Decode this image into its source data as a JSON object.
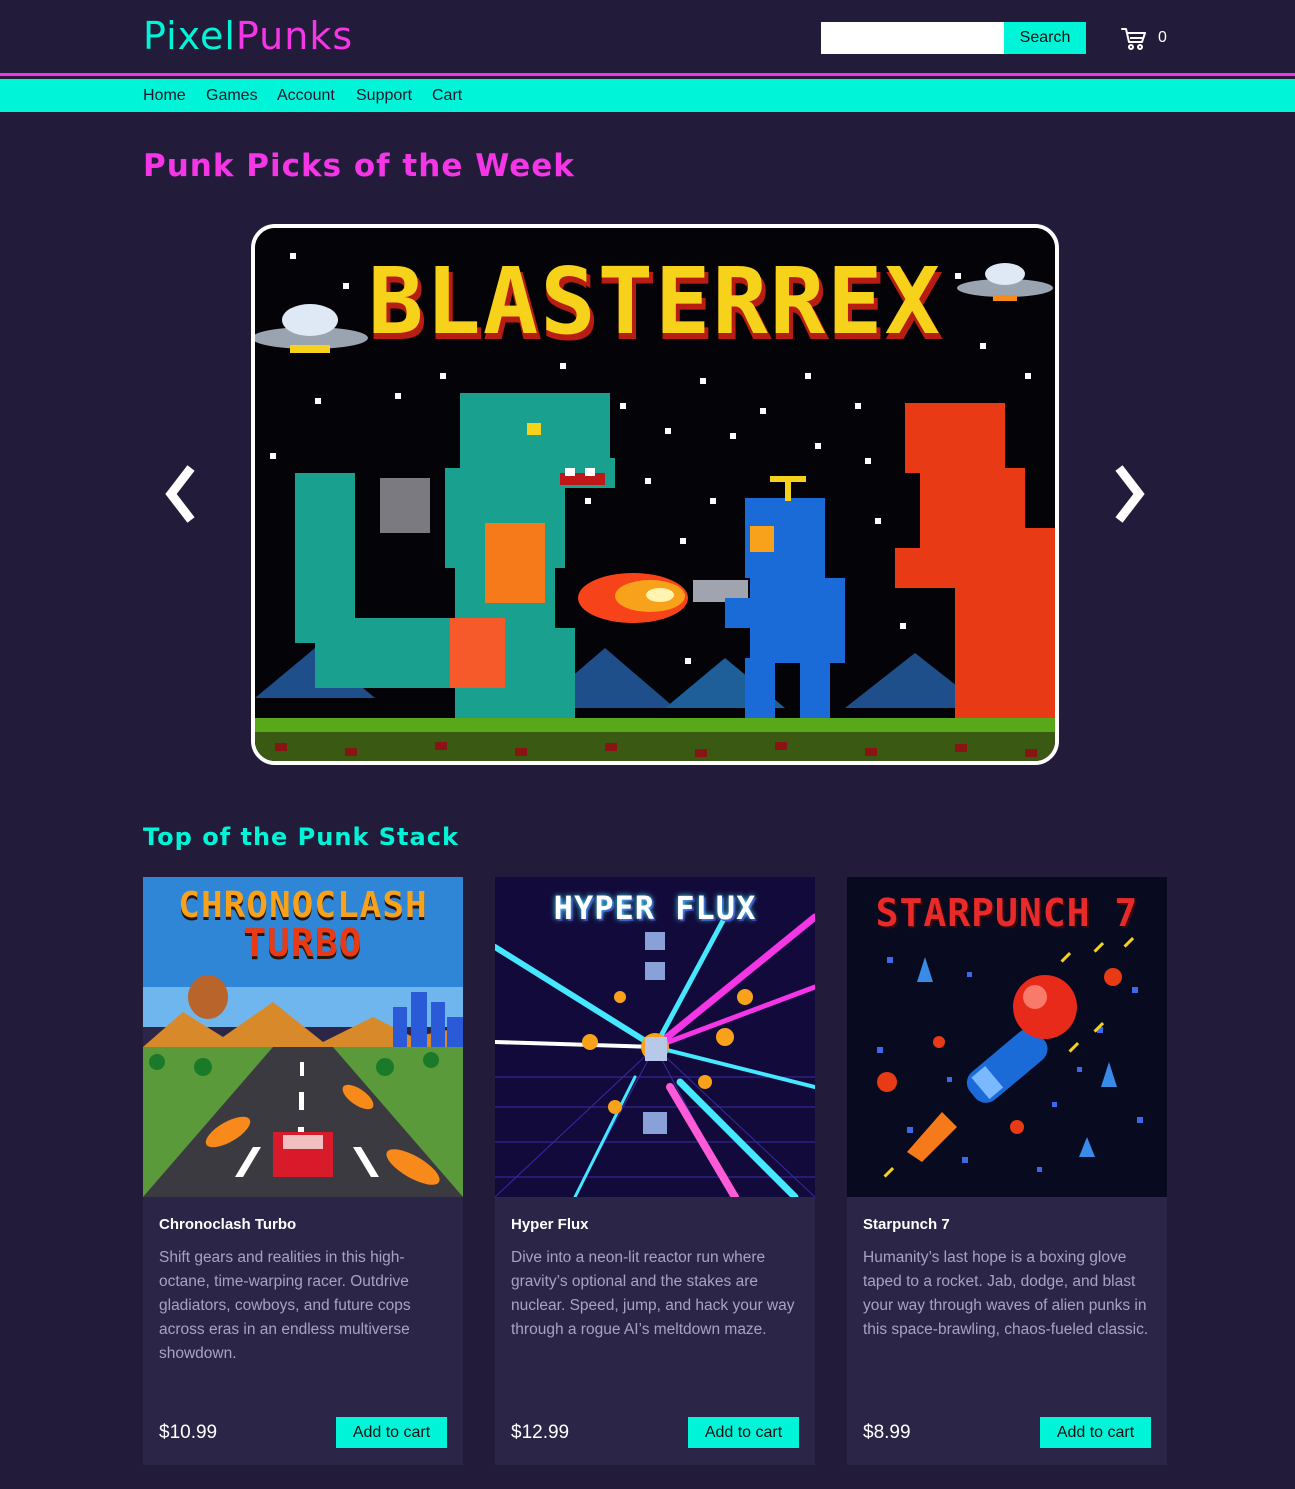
{
  "brand": {
    "logo_part1": "Pixel",
    "logo_part2": "Punks"
  },
  "header": {
    "search_placeholder": "",
    "search_button": "Search",
    "cart_icon": "cart-icon",
    "cart_count": "0"
  },
  "nav": [
    "Home",
    "Games",
    "Account",
    "Support",
    "Cart"
  ],
  "picks": {
    "title": "Punk Picks of the Week",
    "prev_icon": "chevron-left-icon",
    "next_icon": "chevron-right-icon",
    "slide_title": "BLASTERREX"
  },
  "stack": {
    "title": "Top of the Punk Stack",
    "games": [
      {
        "art_title_1": "CHRONOCLASH",
        "art_title_2": "TURBO",
        "name": "Chronoclash Turbo",
        "description": "Shift gears and realities in this high-octane, time-warping racer. Outdrive gladiators, cowboys, and future cops across eras in an endless multiverse showdown.",
        "price": "$10.99",
        "button": "Add to cart"
      },
      {
        "art_title_1": "HYPER FLUX",
        "name": "Hyper Flux",
        "description": "Dive into a neon-lit reactor run where gravity’s optional and the stakes are nuclear. Speed, jump, and hack your way through a rogue AI’s meltdown maze.",
        "price": "$12.99",
        "button": "Add to cart"
      },
      {
        "art_title_1": "STARPUNCH 7",
        "name": "Starpunch 7",
        "description": "Humanity’s last hope is a boxing glove taped to a rocket. Jab, dodge, and blast your way through waves of alien punks in this space-brawling, chaos-fueled classic.",
        "price": "$8.99",
        "button": "Add to cart"
      }
    ]
  },
  "colors": {
    "background": "#221c3a",
    "accent_cyan": "#00f5d8",
    "accent_magenta": "#f536e6",
    "card": "#2b2547"
  }
}
